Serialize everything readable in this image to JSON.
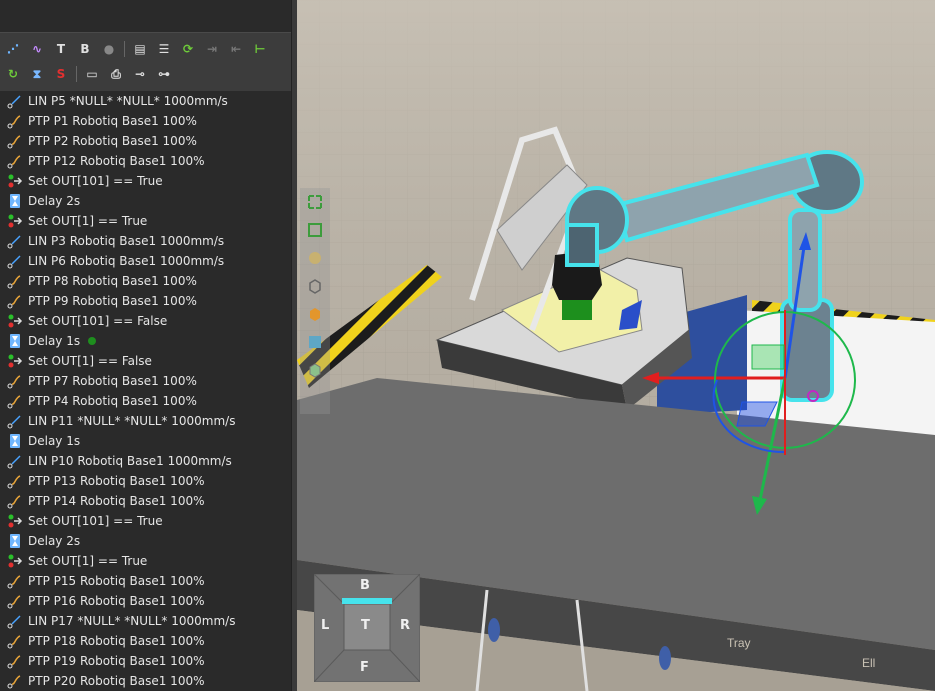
{
  "toolbar": {
    "row1": [
      {
        "name": "points-icon",
        "glyph": "⋰",
        "color": "#6fb6ff"
      },
      {
        "name": "path-icon",
        "glyph": "∿",
        "color": "#c58cff"
      },
      {
        "name": "add-tool-icon",
        "glyph": "T",
        "color": "#e0e0e0"
      },
      {
        "name": "add-base-icon",
        "glyph": "B",
        "color": "#e0e0e0"
      },
      {
        "name": "record-icon",
        "glyph": "●",
        "color": "#888888"
      },
      {
        "name": "sep"
      },
      {
        "name": "script-icon",
        "glyph": "▤",
        "color": "#e0e0e0"
      },
      {
        "name": "list-icon",
        "glyph": "☰",
        "color": "#e0e0e0"
      },
      {
        "name": "loop-icon",
        "glyph": "⟳",
        "color": "#6ecb3a"
      },
      {
        "name": "disabled-1-icon",
        "glyph": "⇥",
        "color": "#777777"
      },
      {
        "name": "disabled-2-icon",
        "glyph": "⇤",
        "color": "#777777"
      },
      {
        "name": "hierarchy-icon",
        "glyph": "⊢",
        "color": "#6ecb3a"
      }
    ],
    "row2": [
      {
        "name": "sync-icon",
        "glyph": "↻",
        "color": "#6ecb3a"
      },
      {
        "name": "delay-icon",
        "glyph": "⧗",
        "color": "#7ab8ff"
      },
      {
        "name": "stop-icon",
        "glyph": "S",
        "color": "#e23030"
      },
      {
        "name": "sep"
      },
      {
        "name": "document-icon",
        "glyph": "▭",
        "color": "#e0e0e0"
      },
      {
        "name": "print-icon",
        "glyph": "⎙",
        "color": "#e0e0e0"
      },
      {
        "name": "set-output-icon",
        "glyph": "⊸",
        "color": "#e0e0e0"
      },
      {
        "name": "signal-icon",
        "glyph": "⊶",
        "color": "#e0e0e0"
      }
    ]
  },
  "program": [
    {
      "type": "lin",
      "text": "LIN P5 *NULL* *NULL* 1000mm/s"
    },
    {
      "type": "ptp",
      "text": "PTP P1 Robotiq Base1 100%"
    },
    {
      "type": "ptp",
      "text": "PTP P2 Robotiq Base1 100%"
    },
    {
      "type": "ptp",
      "text": "PTP P12 Robotiq Base1 100%"
    },
    {
      "type": "out",
      "text": "Set OUT[101] == True"
    },
    {
      "type": "delay",
      "text": "Delay 2s"
    },
    {
      "type": "out",
      "text": "Set OUT[1] == True"
    },
    {
      "type": "lin",
      "text": "LIN P3 Robotiq Base1 1000mm/s"
    },
    {
      "type": "lin",
      "text": "LIN P6 Robotiq Base1 1000mm/s"
    },
    {
      "type": "ptp",
      "text": "PTP P8 Robotiq Base1 100%"
    },
    {
      "type": "ptp",
      "text": "PTP P9 Robotiq Base1 100%"
    },
    {
      "type": "out",
      "text": "Set OUT[101] == False"
    },
    {
      "type": "delay",
      "text": "Delay 1s",
      "active": true
    },
    {
      "type": "out",
      "text": "Set OUT[1] == False"
    },
    {
      "type": "ptp",
      "text": "PTP P7 Robotiq Base1 100%"
    },
    {
      "type": "ptp",
      "text": "PTP P4 Robotiq Base1 100%"
    },
    {
      "type": "lin",
      "text": "LIN P11 *NULL* *NULL* 1000mm/s"
    },
    {
      "type": "delay",
      "text": "Delay 1s"
    },
    {
      "type": "lin",
      "text": "LIN P10 Robotiq Base1 1000mm/s"
    },
    {
      "type": "ptp",
      "text": "PTP P13 Robotiq Base1 100%"
    },
    {
      "type": "ptp",
      "text": "PTP P14 Robotiq Base1 100%"
    },
    {
      "type": "out",
      "text": "Set OUT[101] == True"
    },
    {
      "type": "delay",
      "text": "Delay 2s"
    },
    {
      "type": "out",
      "text": "Set OUT[1] == True"
    },
    {
      "type": "ptp",
      "text": "PTP P15 Robotiq Base1 100%"
    },
    {
      "type": "ptp",
      "text": "PTP P16 Robotiq Base1 100%"
    },
    {
      "type": "lin",
      "text": "LIN P17 *NULL* *NULL* 1000mm/s"
    },
    {
      "type": "ptp",
      "text": "PTP P18 Robotiq Base1 100%"
    },
    {
      "type": "ptp",
      "text": "PTP P19 Robotiq Base1 100%"
    },
    {
      "type": "ptp",
      "text": "PTP P20 Robotiq Base1 100%"
    }
  ],
  "viewport": {
    "navcube": {
      "back": "B",
      "left": "L",
      "top": "T",
      "right": "R",
      "front": "F"
    },
    "side_tools": [
      "fit-view-icon",
      "frame-icon",
      "lock-view-icon",
      "box-view-icon",
      "solid-view-icon",
      "grid-view-icon",
      "render-mode-icon"
    ],
    "highlight_color": "#46e3ec",
    "floor_labels": [
      "Tray",
      "Ell"
    ]
  }
}
